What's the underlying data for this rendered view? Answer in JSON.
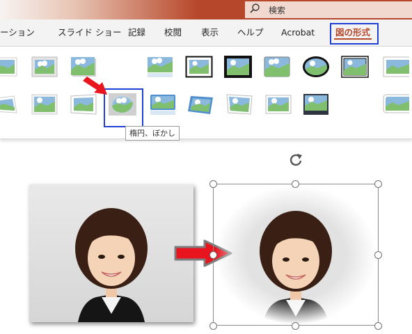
{
  "search": {
    "label": "検索",
    "icon": "search-icon"
  },
  "ribbon": {
    "tabs": [
      {
        "label": "ーション"
      },
      {
        "label": "スライド ショー"
      },
      {
        "label": "記録"
      },
      {
        "label": "校閲"
      },
      {
        "label": "表示"
      },
      {
        "label": "ヘルプ"
      },
      {
        "label": "Acrobat"
      },
      {
        "label": "図の形式",
        "active": true
      }
    ]
  },
  "gallery": {
    "row1": [
      "simple-frame-white",
      "soft-edge-rect",
      "drop-shadow-rect",
      "reflected-rect",
      "simple-frame-black",
      "thick-matte-black",
      "rounded-rect",
      "metal-oval",
      "double-frame-black",
      "rotated-white"
    ],
    "row2": [
      "perspective-shadow",
      "soft-edge-rect-2",
      "beveled-matte",
      "soft-edge-oval",
      "reflected-bevel",
      "perspective-tilted",
      "relaxed-perspective",
      "bevel-perspective",
      "center-shadow",
      "reflected-rounded"
    ],
    "selected": "soft-edge-oval"
  },
  "tooltip": {
    "text": "楕円、ぼかし"
  },
  "colors": {
    "accent": "#b7472a",
    "callout": "#1f3fd6",
    "arrow": "#e8141e"
  },
  "icons": {
    "rotate": "rotate-handle-icon",
    "arrow": "arrow-right-icon",
    "pointer": "pointer-arrow-icon"
  }
}
